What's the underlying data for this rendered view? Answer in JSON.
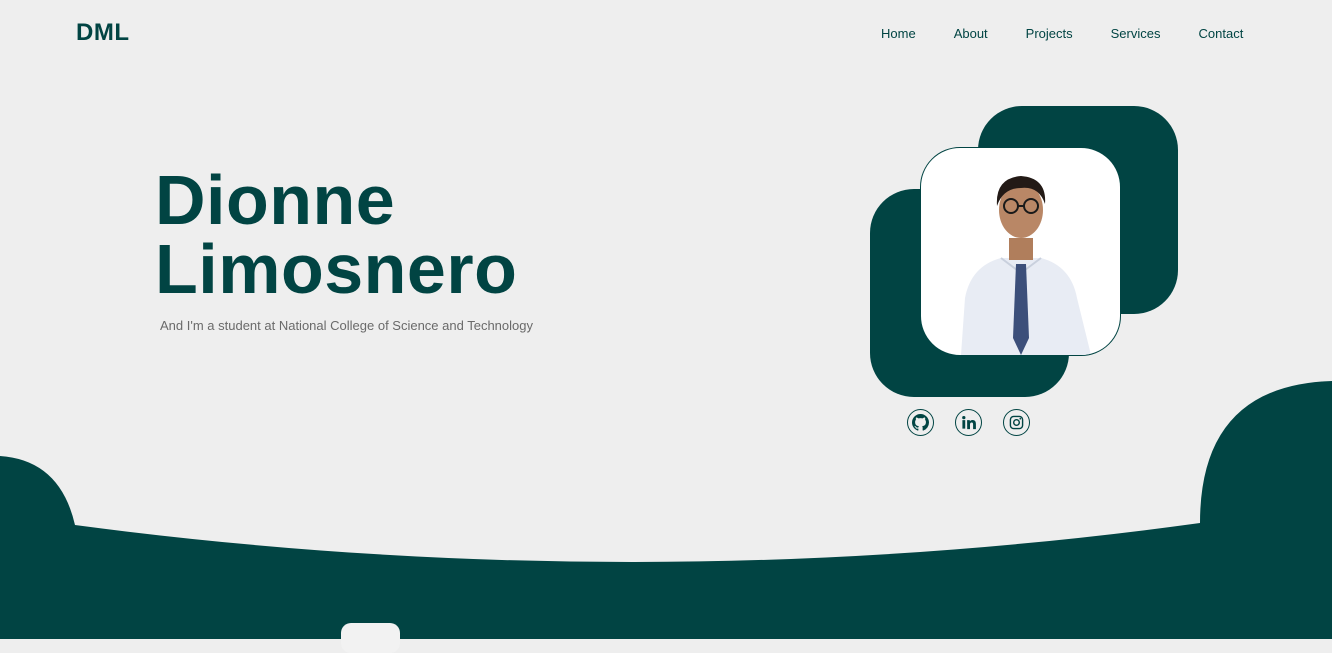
{
  "brand": {
    "logo_text": "DML"
  },
  "nav": {
    "items": [
      {
        "label": "Home"
      },
      {
        "label": "About"
      },
      {
        "label": "Projects"
      },
      {
        "label": "Services"
      },
      {
        "label": "Contact"
      }
    ]
  },
  "hero": {
    "first_name": "Dionne",
    "last_name": "Limosnero",
    "tagline": "And I'm a student at National College of Science and Technology"
  },
  "socials": [
    {
      "icon": "github-icon"
    },
    {
      "icon": "linkedin-icon"
    },
    {
      "icon": "instagram-icon"
    }
  ],
  "colors": {
    "primary": "#014443",
    "background": "#eeeeee",
    "muted_text": "#6a6a6a"
  }
}
